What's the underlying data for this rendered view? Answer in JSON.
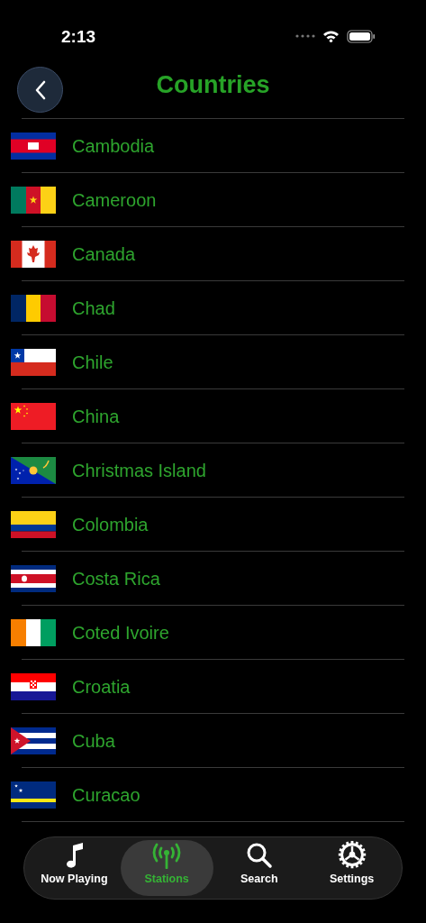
{
  "status_bar": {
    "time": "2:13"
  },
  "header": {
    "title": "Countries"
  },
  "countries": [
    {
      "name": "Cambodia",
      "kind": "kh"
    },
    {
      "name": "Cameroon",
      "kind": "cm"
    },
    {
      "name": "Canada",
      "kind": "ca"
    },
    {
      "name": "Chad",
      "kind": "td"
    },
    {
      "name": "Chile",
      "kind": "cl"
    },
    {
      "name": "China",
      "kind": "cn"
    },
    {
      "name": "Christmas Island",
      "kind": "cx"
    },
    {
      "name": "Colombia",
      "kind": "co"
    },
    {
      "name": "Costa Rica",
      "kind": "cr"
    },
    {
      "name": "Coted Ivoire",
      "kind": "ci"
    },
    {
      "name": "Croatia",
      "kind": "hr"
    },
    {
      "name": "Cuba",
      "kind": "cu"
    },
    {
      "name": "Curacao",
      "kind": "cw"
    }
  ],
  "tabs": [
    {
      "label": "Now Playing",
      "kind": "music",
      "selected": false
    },
    {
      "label": "Stations",
      "kind": "antenna",
      "selected": true
    },
    {
      "label": "Search",
      "kind": "search",
      "selected": false
    },
    {
      "label": "Settings",
      "kind": "gear",
      "selected": false
    }
  ]
}
